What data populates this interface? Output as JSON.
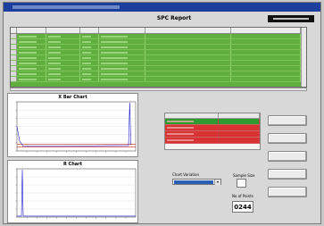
{
  "window": {
    "title": ""
  },
  "header": {
    "title": "SPC Report",
    "clock": ""
  },
  "grid": {
    "columns": [
      "",
      "",
      "",
      "",
      "",
      "",
      ""
    ],
    "row_count": 9,
    "row_color": "#5fae3e"
  },
  "charts": [
    {
      "id": "x-bar",
      "title": "X Bar Chart"
    },
    {
      "id": "r-chart",
      "title": "R Chart"
    }
  ],
  "fail_table": {
    "columns": [
      "",
      ""
    ],
    "rows": [
      {
        "color": "#2f9a2f"
      },
      {
        "color": "#d83232"
      },
      {
        "color": "#d83232"
      },
      {
        "color": "#d83232"
      }
    ]
  },
  "controls": {
    "chart_variation_label": "Chart Variation",
    "chart_variation_value": "",
    "sample_size_label": "Sample Size",
    "sample_size_value": "",
    "no_of_points_label": "No of Points",
    "no_of_points_value": "0244"
  },
  "buttons": [
    {
      "label": ""
    },
    {
      "label": ""
    },
    {
      "label": ""
    },
    {
      "label": ""
    },
    {
      "label": ""
    }
  ],
  "chart_data": [
    {
      "type": "line",
      "title": "X Bar Chart",
      "xlabel": "",
      "ylabel": ""
    },
    {
      "type": "line",
      "title": "R Chart",
      "xlabel": "",
      "ylabel": ""
    }
  ]
}
